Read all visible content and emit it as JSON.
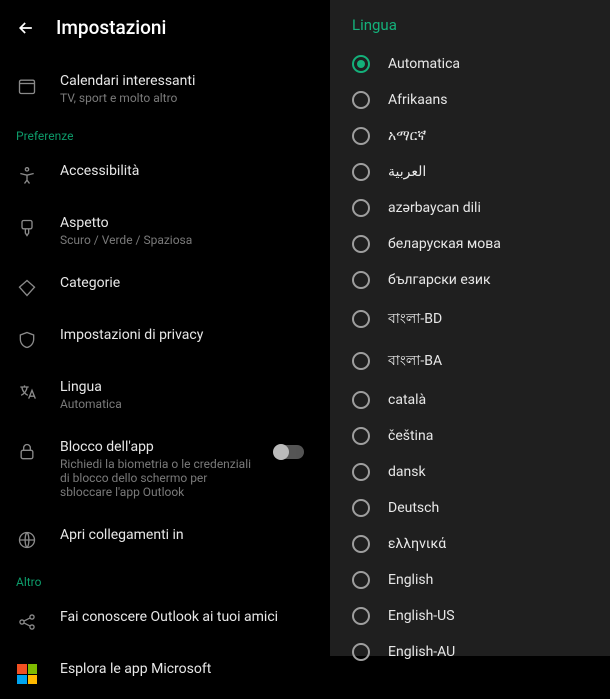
{
  "header": {
    "title": "Impostazioni"
  },
  "calendars": {
    "label": "Calendari interessanti",
    "sub": "TV, sport e molto altro"
  },
  "sections": {
    "preferences": "Preferenze",
    "other": "Altro",
    "peek_pref": "Pr",
    "peek_alt": "Al"
  },
  "items": {
    "accessibility": {
      "label": "Accessibilità"
    },
    "appearance": {
      "label": "Aspetto",
      "sub": "Scuro / Verde / Spaziosa"
    },
    "categories": {
      "label": "Categorie"
    },
    "privacy": {
      "label": "Impostazioni di privacy"
    },
    "language": {
      "label": "Lingua",
      "sub": "Automatica"
    },
    "applock": {
      "label": "Blocco dell'app",
      "sub": "Richiedi la biometria o le credenziali di blocco dello schermo per sbloccare l'app Outlook"
    },
    "openlinks": {
      "label": "Apri collegamenti in"
    },
    "share": {
      "label": "Fai conoscere Outlook ai tuoi amici"
    },
    "msapps": {
      "label": "Esplora le app Microsoft"
    }
  },
  "langPanel": {
    "title": "Lingua",
    "selected": 0,
    "options": [
      "Automatica",
      "Afrikaans",
      "አማርኛ",
      "العربية",
      "azərbaycan dili",
      "беларуская мова",
      "български език",
      "বাংলা-BD",
      "বাংলা-BA",
      "català",
      "čeština",
      "dansk",
      "Deutsch",
      "ελληνικά",
      "English",
      "English-US",
      "English-AU"
    ]
  }
}
